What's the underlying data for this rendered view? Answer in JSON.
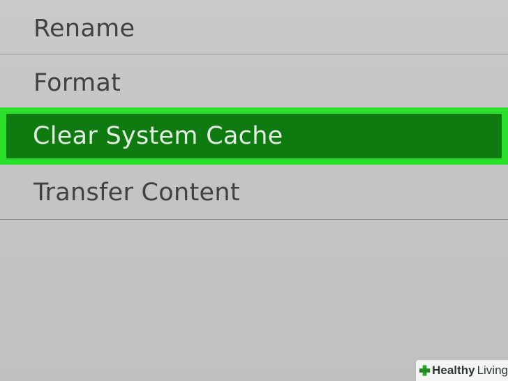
{
  "menu": {
    "items": [
      {
        "label": "Rename"
      },
      {
        "label": "Format"
      },
      {
        "label": "Clear System Cache",
        "selected": true
      },
      {
        "label": "Transfer Content"
      }
    ]
  },
  "colors": {
    "selected_fill": "#0f7a10",
    "selected_outline": "#2be02b",
    "background": "#c6c8c8",
    "text": "#3f4242"
  },
  "watermark": {
    "brand_bold": "Healthy",
    "brand_light": "Living",
    "icon": "cross-icon"
  }
}
